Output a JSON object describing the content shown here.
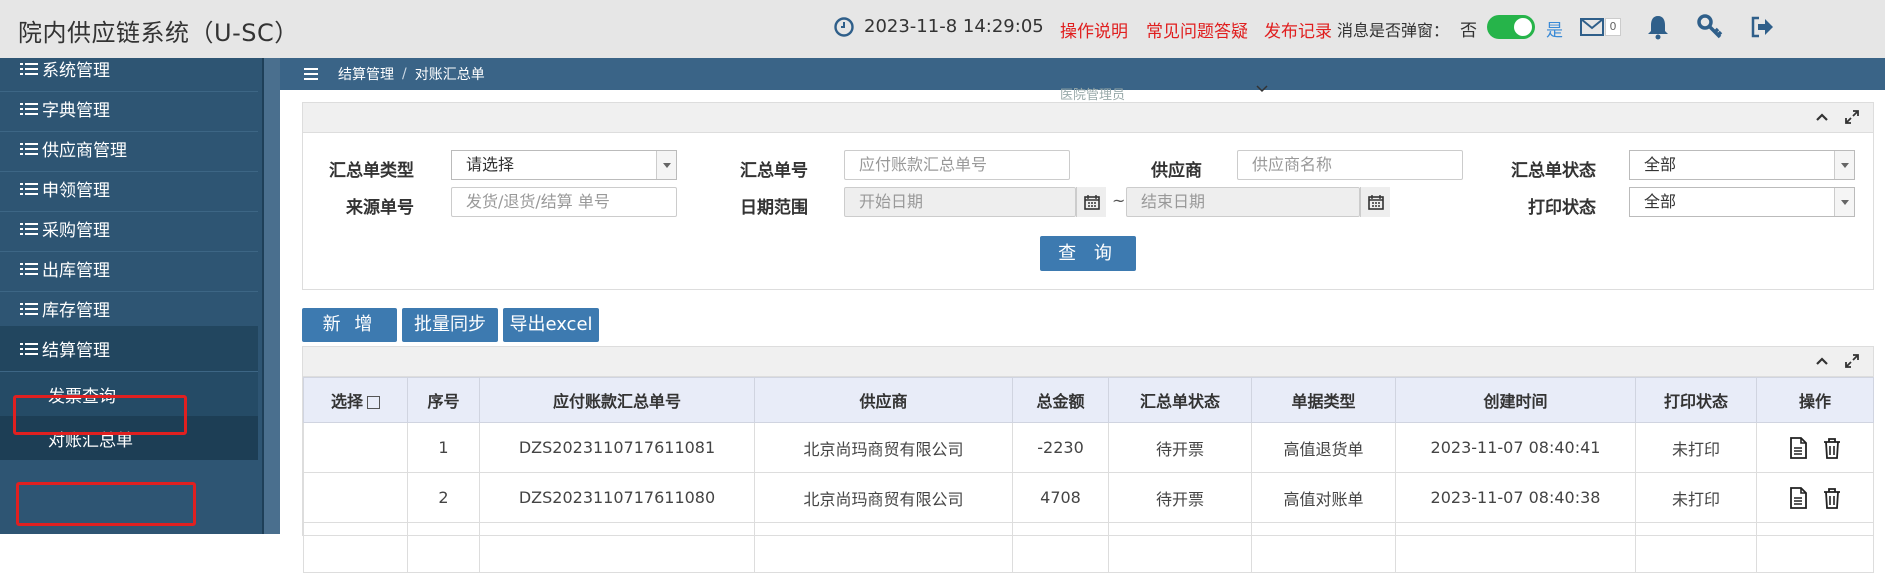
{
  "app": {
    "title": "院内供应链系统（U-SC）",
    "datetime": "2023-11-8  14:29:05",
    "links": [
      "操作说明",
      "常见问题答疑",
      "发布记录"
    ],
    "popup_label": "消息是否弹窗：",
    "toggle_no": "否",
    "toggle_yes": "是",
    "toggle_on": true,
    "mail_count": "0",
    "accent_color": "#3d7ab0"
  },
  "sidebar": {
    "items": [
      {
        "label": "系统管理"
      },
      {
        "label": "字典管理"
      },
      {
        "label": "供应商管理"
      },
      {
        "label": "申领管理"
      },
      {
        "label": "采购管理"
      },
      {
        "label": "出库管理"
      },
      {
        "label": "库存管理"
      },
      {
        "label": "结算管理"
      }
    ],
    "subitems": [
      {
        "label": "发票查询"
      },
      {
        "label": "对账汇总单"
      }
    ]
  },
  "breadcrumb": {
    "parent": "结算管理",
    "separator": "/",
    "current": "对账汇总单",
    "faded_text": "医院管理员"
  },
  "filters": {
    "type_label": "汇总单类型",
    "type_value": "请选择",
    "no_label": "汇总单号",
    "no_placeholder": "应付账款汇总单号",
    "supplier_label": "供应商",
    "supplier_placeholder": "供应商名称",
    "status_label": "汇总单状态",
    "status_value": "全部",
    "source_label": "来源单号",
    "source_placeholder": "发货/退货/结算 单号",
    "date_label": "日期范围",
    "start_placeholder": "开始日期",
    "date_sep": "~",
    "end_placeholder": "结束日期",
    "print_label": "打印状态",
    "print_value": "全部",
    "query_button": "查 询"
  },
  "toolbar": {
    "add_button": "新 增",
    "sync_button": "批量同步",
    "export_button": "导出excel"
  },
  "table": {
    "headers": [
      "选择",
      "序号",
      "应付账款汇总单号",
      "供应商",
      "总金额",
      "汇总单状态",
      "单据类型",
      "创建时间",
      "打印状态",
      "操作"
    ],
    "rows": [
      {
        "seq": "1",
        "no": "DZS2023110717611081",
        "supplier": "北京尚玛商贸有限公司",
        "amount": "-2230",
        "status": "待开票",
        "doc_type": "高值退货单",
        "created": "2023-11-07 08:40:41",
        "print": "未打印"
      },
      {
        "seq": "2",
        "no": "DZS2023110717611080",
        "supplier": "北京尚玛商贸有限公司",
        "amount": "4708",
        "status": "待开票",
        "doc_type": "高值对账单",
        "created": "2023-11-07 08:40:38",
        "print": "未打印"
      }
    ]
  }
}
